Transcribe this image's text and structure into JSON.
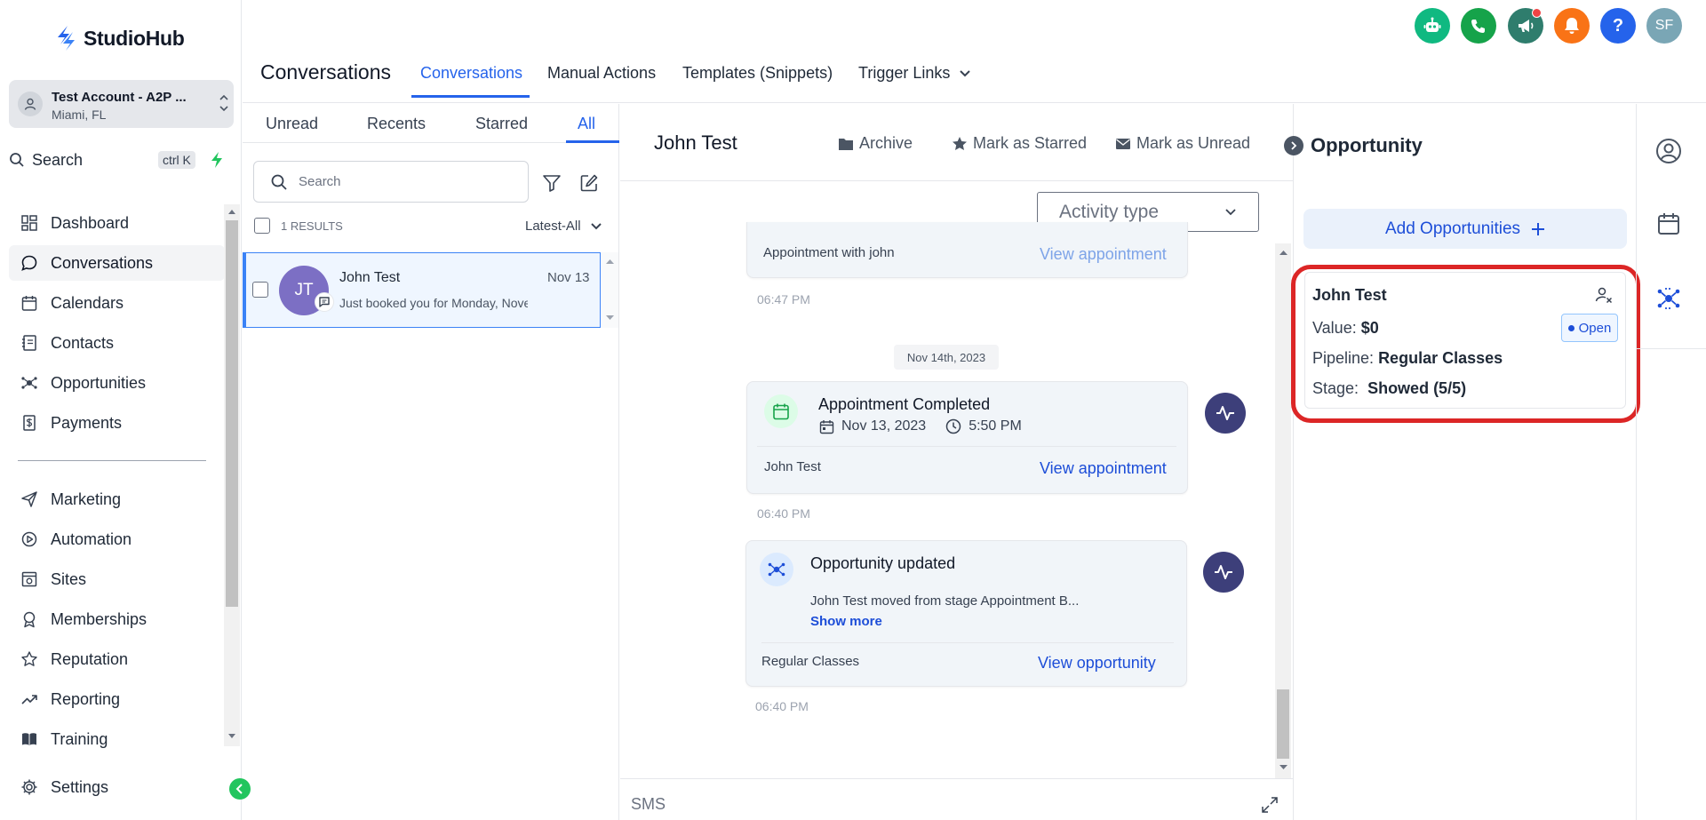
{
  "brand": {
    "name": "StudioHub"
  },
  "account": {
    "name": "Test Account - A2P ...",
    "location": "Miami, FL"
  },
  "sidebar": {
    "search_label": "Search",
    "search_shortcut": "ctrl K",
    "items": [
      {
        "label": "Dashboard",
        "icon": "dashboard-icon"
      },
      {
        "label": "Conversations",
        "icon": "chat-icon"
      },
      {
        "label": "Calendars",
        "icon": "calendar-icon"
      },
      {
        "label": "Contacts",
        "icon": "contacts-icon"
      },
      {
        "label": "Opportunities",
        "icon": "opportunities-icon"
      },
      {
        "label": "Payments",
        "icon": "payments-icon"
      },
      {
        "label": "Marketing",
        "icon": "send-icon"
      },
      {
        "label": "Automation",
        "icon": "automation-icon"
      },
      {
        "label": "Sites",
        "icon": "sites-icon"
      },
      {
        "label": "Memberships",
        "icon": "award-icon"
      },
      {
        "label": "Reputation",
        "icon": "star-icon"
      },
      {
        "label": "Reporting",
        "icon": "trend-icon"
      },
      {
        "label": "Training",
        "icon": "book-icon"
      }
    ],
    "settings_label": "Settings"
  },
  "header": {
    "title": "Conversations",
    "tabs": [
      {
        "label": "Conversations",
        "active": true
      },
      {
        "label": "Manual Actions"
      },
      {
        "label": "Templates (Snippets)"
      },
      {
        "label": "Trigger Links"
      }
    ],
    "user_initials": "SF",
    "help_glyph": "?"
  },
  "list": {
    "tabs": [
      {
        "label": "Unread"
      },
      {
        "label": "Recents"
      },
      {
        "label": "Starred"
      },
      {
        "label": "All",
        "active": true
      }
    ],
    "search_placeholder": "Search",
    "results": "1 RESULTS",
    "sort": "Latest-All",
    "conversations": [
      {
        "initials": "JT",
        "name": "John Test",
        "date": "Nov 13",
        "preview": "Just booked you for Monday, November"
      }
    ]
  },
  "conversation": {
    "contact_name": "John Test",
    "actions": {
      "archive": "Archive",
      "star": "Mark as Starred",
      "unread": "Mark as Unread"
    },
    "activity_filter": "Activity type",
    "events": {
      "prev_card": {
        "text": "Appointment with john",
        "link": "View appointment",
        "time": "06:47 PM"
      },
      "date_divider": "Nov 14th, 2023",
      "appointment": {
        "title": "Appointment Completed",
        "date": "Nov 13, 2023",
        "time_of_day": "5:50 PM",
        "contact": "John Test",
        "link": "View appointment",
        "time": "06:40 PM"
      },
      "opportunity": {
        "title": "Opportunity updated",
        "description": "John Test moved from stage Appointment B...",
        "show_more": "Show more",
        "pipeline": "Regular Classes",
        "link": "View opportunity",
        "time": "06:40 PM"
      }
    },
    "composer_channel": "SMS"
  },
  "opportunity_panel": {
    "title": "Opportunity",
    "add_button": "Add Opportunities",
    "card": {
      "name": "John Test",
      "value_label": "Value:",
      "value": "$0",
      "status": "Open",
      "pipeline_label": "Pipeline:",
      "pipeline": "Regular Classes",
      "stage_label": "Stage:",
      "stage": "Showed (5/5)"
    }
  },
  "colors": {
    "accent": "#2563eb",
    "highlight": "#dc2626",
    "bot_green": "#10b981",
    "phone_green": "#16a34a",
    "megaphone_teal": "#2f7d6d",
    "bell_orange": "#f97316",
    "help_blue": "#2563eb",
    "avatar_grey": "#7aa6b5"
  }
}
